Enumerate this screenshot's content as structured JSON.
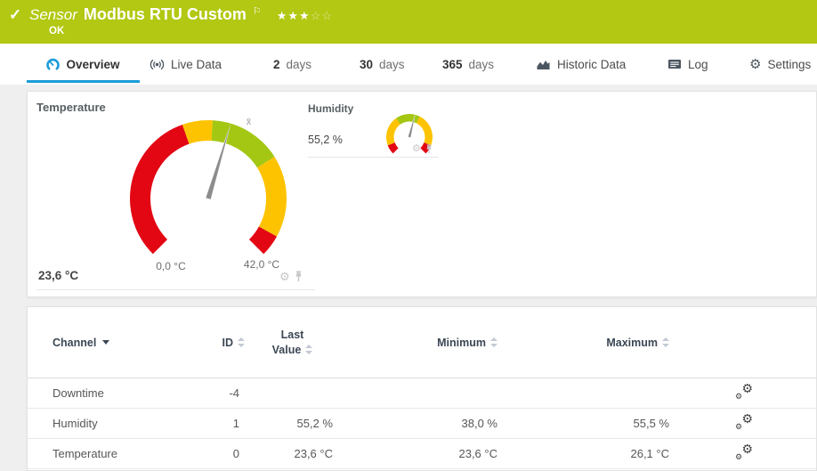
{
  "header": {
    "type_label": "Sensor",
    "title": "Modbus RTU Custom",
    "status": "OK",
    "priority_filled": 3,
    "priority_total": 5
  },
  "tabs": {
    "overview": "Overview",
    "live_data": "Live Data",
    "d2_num": "2",
    "d2_word": "days",
    "d30_num": "30",
    "d30_word": "days",
    "d365_num": "365",
    "d365_word": "days",
    "historic": "Historic Data",
    "log": "Log",
    "settings": "Settings"
  },
  "colors": {
    "banner": "#b2c812",
    "accent": "#1b9dd9",
    "red": "#e30613",
    "yellow": "#fdc300",
    "green": "#a4c713",
    "needle": "#8c8c8c"
  },
  "gauges": {
    "temperature": {
      "title": "Temperature",
      "value": 23.6,
      "value_label": "23,6 °C",
      "scale_min": 0,
      "scale_max": 42,
      "scale_min_label": "0,0 °C",
      "scale_max_label": "42,0 °C",
      "average_value": 25.3,
      "average_marker": "x̄",
      "segments": [
        {
          "from": 0,
          "to": 18,
          "color": "red"
        },
        {
          "from": 18,
          "to": 21.5,
          "color": "yellow"
        },
        {
          "from": 21.5,
          "to": 30,
          "color": "green"
        },
        {
          "from": 30,
          "to": 39.5,
          "color": "yellow"
        },
        {
          "from": 39.5,
          "to": 42,
          "color": "red"
        }
      ]
    },
    "humidity": {
      "title": "Humidity",
      "value": 55.2,
      "value_label": "55,2 %",
      "scale_min": 0,
      "scale_max": 100,
      "average_value": 48,
      "average_marker": "",
      "segments": [
        {
          "from": 0,
          "to": 9,
          "color": "red"
        },
        {
          "from": 9,
          "to": 37,
          "color": "yellow"
        },
        {
          "from": 37,
          "to": 60,
          "color": "green"
        },
        {
          "from": 60,
          "to": 91,
          "color": "yellow"
        },
        {
          "from": 91,
          "to": 100,
          "color": "red"
        }
      ]
    }
  },
  "table": {
    "headers": {
      "channel": "Channel",
      "id": "ID",
      "last_line1": "Last",
      "last_line2": "Value",
      "minimum": "Minimum",
      "maximum": "Maximum"
    },
    "rows": [
      {
        "channel": "Downtime",
        "id": "-4",
        "last": "",
        "min": "",
        "max": ""
      },
      {
        "channel": "Humidity",
        "id": "1",
        "last": "55,2 %",
        "min": "38,0 %",
        "max": "55,5 %"
      },
      {
        "channel": "Temperature",
        "id": "0",
        "last": "23,6 °C",
        "min": "23,6 °C",
        "max": "26,1 °C"
      }
    ]
  }
}
